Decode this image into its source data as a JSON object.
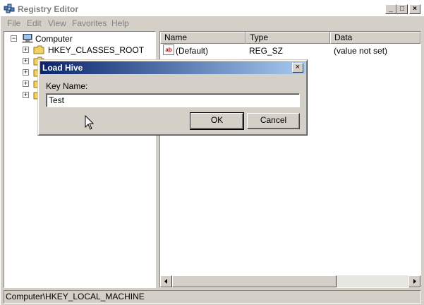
{
  "app": {
    "title": "Registry Editor",
    "controls": {
      "minimize": "_",
      "maximize": "□",
      "close": "×"
    }
  },
  "menu": [
    "File",
    "Edit",
    "View",
    "Favorites",
    "Help"
  ],
  "tree": {
    "root": {
      "label": "Computer",
      "icon": "computer-icon",
      "expander": "−"
    },
    "items": [
      {
        "label": "HKEY_CLASSES_ROOT",
        "expander": "+"
      },
      {
        "label": "",
        "expander": "+"
      },
      {
        "label": "",
        "expander": "+"
      },
      {
        "label": "",
        "expander": "+"
      },
      {
        "label": "",
        "expander": "+"
      }
    ]
  },
  "list": {
    "columns": [
      "Name",
      "Type",
      "Data"
    ],
    "rows": [
      {
        "icon": "string-value-icon",
        "icon_text": "ab",
        "name": "(Default)",
        "type": "REG_SZ",
        "data": "(value not set)"
      }
    ]
  },
  "status": {
    "path": "Computer\\HKEY_LOCAL_MACHINE"
  },
  "dialog": {
    "title": "Load Hive",
    "close": "×",
    "label": "Key Name:",
    "value": "Test",
    "ok": "OK",
    "cancel": "Cancel"
  },
  "colors": {
    "window_bg": "#d4d0c8",
    "dialog_title_start": "#0a246a",
    "dialog_title_end": "#a6caf0",
    "inactive_title_text": "#808080"
  }
}
